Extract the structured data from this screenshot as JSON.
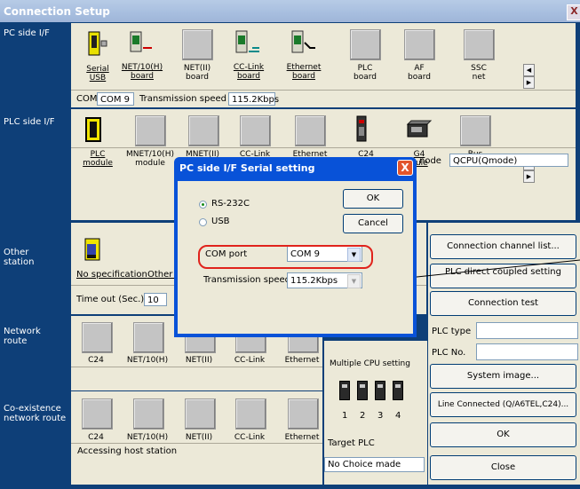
{
  "window": {
    "title": "Connection Setup",
    "close_glyph": "X"
  },
  "pc_side": {
    "label": "PC side I/F",
    "items": [
      {
        "l1": "Serial",
        "l2": "USB",
        "underline": true
      },
      {
        "l1": "NET/10(H)",
        "l2": "board",
        "underline": true
      },
      {
        "l1": "NET(II)",
        "l2": "board",
        "underline": false
      },
      {
        "l1": "CC-Link",
        "l2": "board",
        "underline": true
      },
      {
        "l1": "Ethernet",
        "l2": "board",
        "underline": true
      },
      {
        "l1": "PLC",
        "l2": "board",
        "underline": false
      },
      {
        "l1": "AF",
        "l2": "board",
        "underline": false
      },
      {
        "l1": "SSC",
        "l2": "net",
        "underline": false
      }
    ],
    "com_label": "COM",
    "com_value": "COM 9",
    "speed_label": "Transmission speed",
    "speed_value": "115.2Kbps"
  },
  "plc_side": {
    "label": "PLC side I/F",
    "items": [
      {
        "l1": "PLC",
        "l2": "module"
      },
      {
        "l1": "MNET/10(H)",
        "l2": "module"
      },
      {
        "l1": "MNET(II)",
        "l2": ""
      },
      {
        "l1": "CC-Link",
        "l2": ""
      },
      {
        "l1": "Ethernet",
        "l2": ""
      },
      {
        "l1": "C24",
        "l2": ""
      },
      {
        "l1": "G4",
        "l2": "dule"
      },
      {
        "l1": "Bus",
        "l2": ""
      }
    ],
    "mode_label": "node",
    "mode_value": "QCPU(Qmode)"
  },
  "other_station": {
    "label_l1": "Other",
    "label_l2": "station",
    "no_spec": "No specification",
    "other": "Other s",
    "timeout_label": "Time out (Sec.)",
    "timeout_value": "10"
  },
  "network_route": {
    "label_l1": "Network",
    "label_l2": "route",
    "items": [
      "C24",
      "NET/10(H)",
      "NET(II)",
      "CC-Link",
      "Ethernet"
    ]
  },
  "coexist_route": {
    "label_l1": "Co-existence",
    "label_l2": "network route",
    "items": [
      "C24",
      "NET/10(H)",
      "NET(II)",
      "CC-Link",
      "Ethernet"
    ],
    "status": "Accessing host station"
  },
  "multi_cpu": {
    "label": "Multiple CPU setting",
    "nums": [
      "1",
      "2",
      "3",
      "4"
    ],
    "target_label": "Target PLC",
    "target_value": "No Choice made"
  },
  "right": {
    "channel_list": "Connection channel list...",
    "plc_direct": "PLC direct coupled setting",
    "conn_test": "Connection test",
    "plc_type_label": "PLC type",
    "plc_no_label": "PLC No.",
    "system_image": "System image...",
    "line_connected": "Line Connected (Q/A6TEL,C24)...",
    "ok": "OK",
    "close": "Close"
  },
  "dialog": {
    "title": "PC side I/F  Serial setting",
    "close_glyph": "X",
    "rs232c": "RS-232C",
    "usb": "USB",
    "ok": "OK",
    "cancel": "Cancel",
    "com_port_label": "COM port",
    "com_port_value": "COM 9",
    "speed_label": "Transmission speed",
    "speed_value": "115.2Kbps"
  },
  "colors": {
    "window_bg": "#0e3f78",
    "dialog_title": "#0852d8",
    "callout": "#e0231c"
  }
}
